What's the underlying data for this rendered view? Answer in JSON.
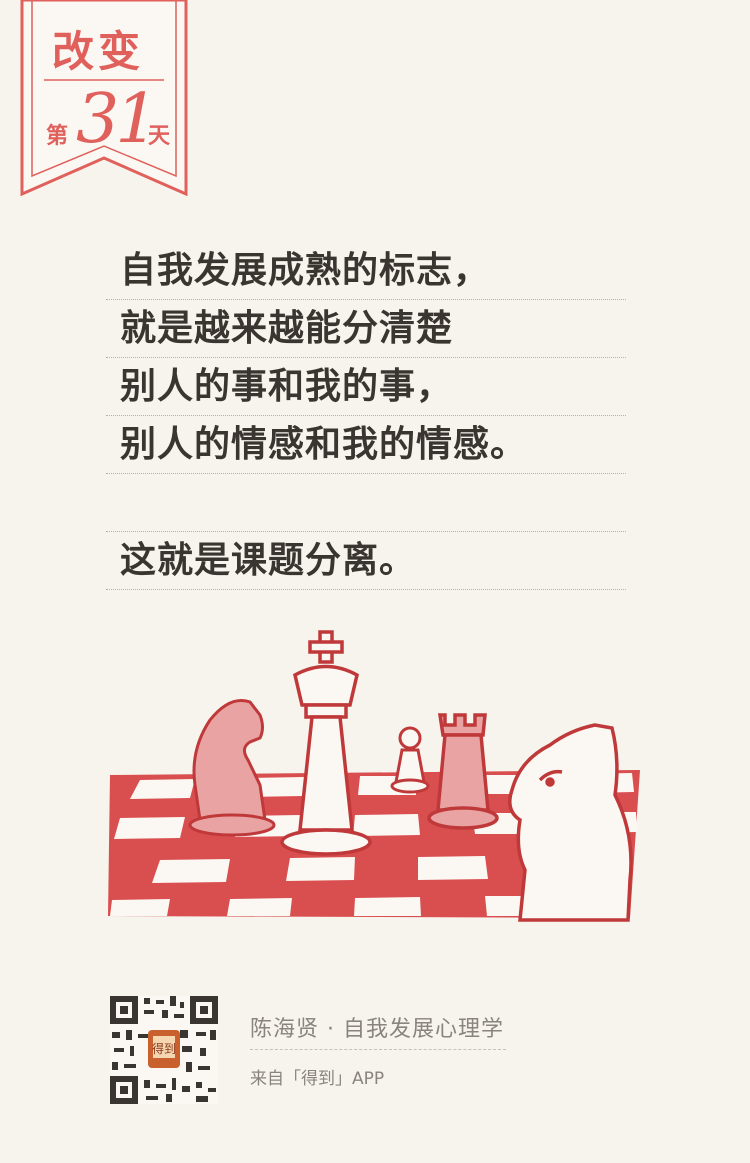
{
  "badge": {
    "title": "改变",
    "prefix": "第",
    "number": "31",
    "suffix": "天",
    "color": "#e0605c"
  },
  "quote": {
    "lines": [
      "自我发展成熟的标志，",
      "就是越来越能分清楚",
      "别人的事和我的事，",
      "别人的情感和我的情感。"
    ],
    "conclusion": "这就是课题分离。"
  },
  "illustration": {
    "icon": "chess-pieces-icon",
    "accent_color": "#d94e4e"
  },
  "footer": {
    "author_line": "陈海贤 · 自我发展心理学",
    "source_line": "来自「得到」APP",
    "qr_icon": "qr-code-icon"
  }
}
